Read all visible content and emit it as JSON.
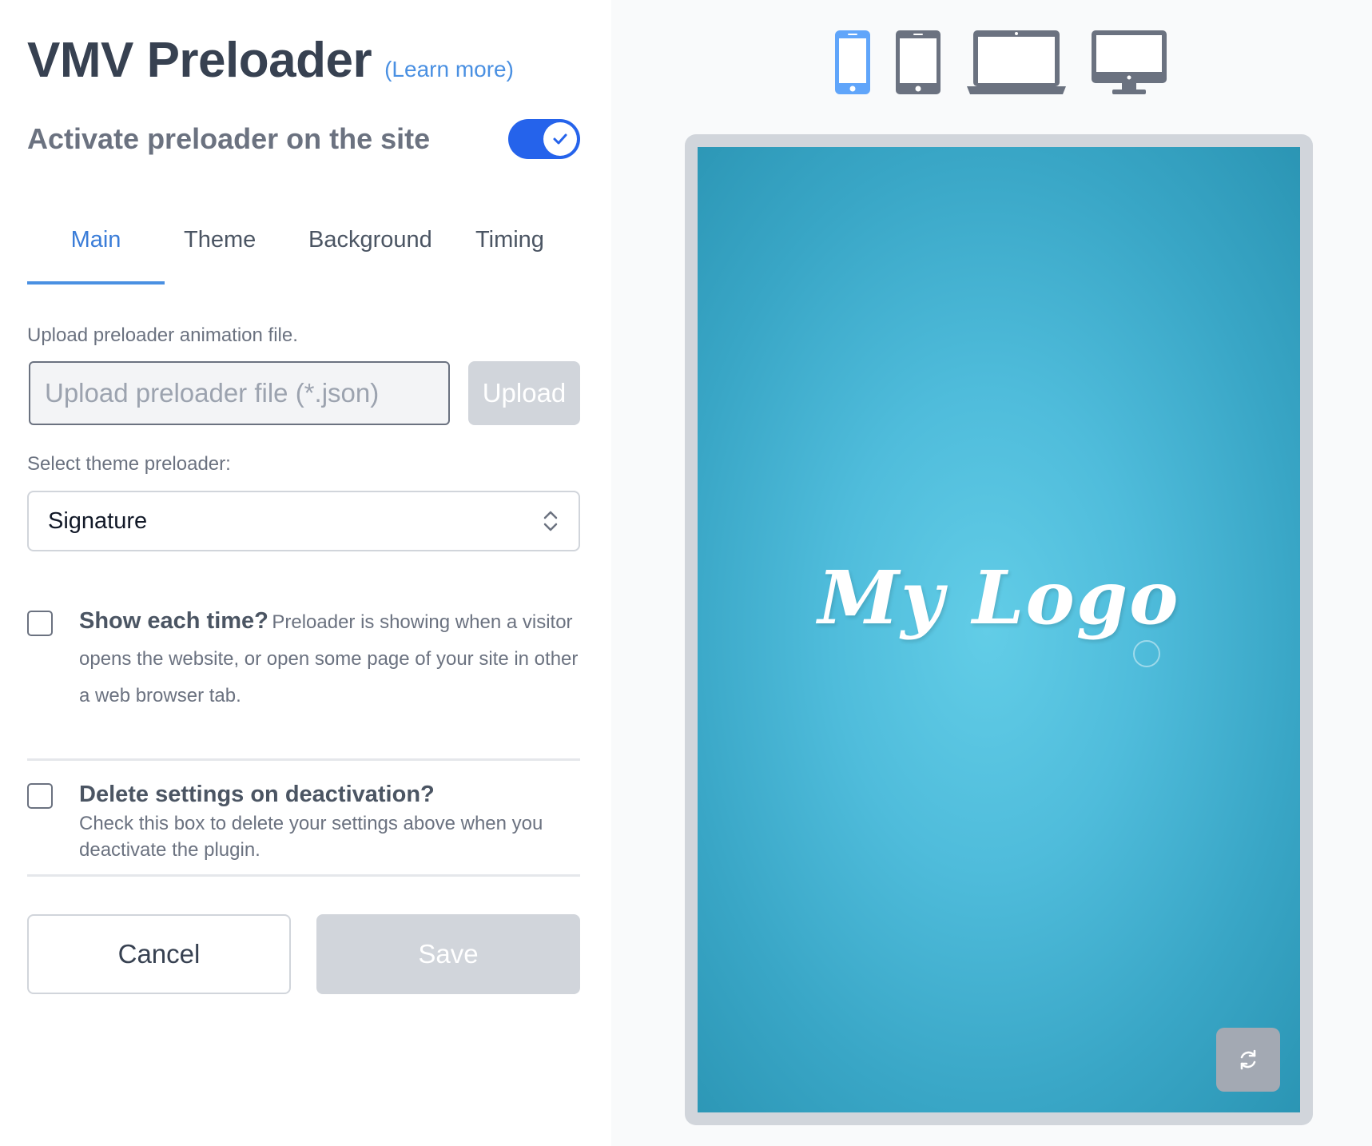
{
  "header": {
    "title": "VMV Preloader",
    "learn_more": "(Learn more)"
  },
  "activate": {
    "label": "Activate preloader on the site",
    "enabled": true
  },
  "tabs": [
    {
      "label": "Main",
      "active": true
    },
    {
      "label": "Theme",
      "active": false
    },
    {
      "label": "Background",
      "active": false
    },
    {
      "label": "Timing",
      "active": false
    }
  ],
  "upload": {
    "label": "Upload preloader animation file.",
    "placeholder": "Upload preloader file (*.json)",
    "button": "Upload"
  },
  "theme_select": {
    "label": "Select theme preloader:",
    "value": "Signature"
  },
  "show_each_time": {
    "title": "Show each time?",
    "description": "Preloader is showing when a visitor opens the website, or open some page of your site in other a web browser tab.",
    "checked": false
  },
  "delete_settings": {
    "title": "Delete settings on deactivation?",
    "description": "Check this box to delete your settings above when you deactivate the plugin.",
    "checked": false
  },
  "actions": {
    "cancel": "Cancel",
    "save": "Save"
  },
  "devices": [
    {
      "name": "phone",
      "active": true
    },
    {
      "name": "tablet",
      "active": false
    },
    {
      "name": "laptop",
      "active": false
    },
    {
      "name": "desktop",
      "active": false
    }
  ],
  "preview": {
    "logo_text": "My Logo"
  },
  "colors": {
    "accent": "#2563eb",
    "tab_active": "#3b7dd8",
    "device_active": "#60a5fa",
    "device_inactive": "#6b7280",
    "preview_bg": "#4fbcdb"
  }
}
